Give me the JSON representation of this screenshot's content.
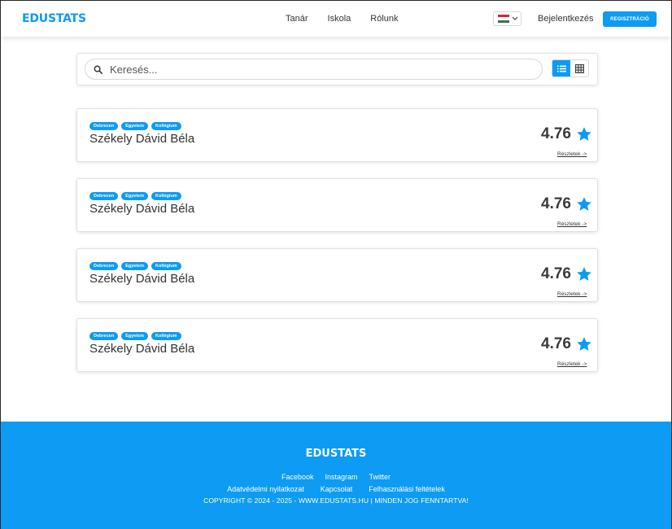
{
  "header": {
    "brand": "EDUSTATS",
    "nav": [
      "Tanár",
      "Iskola",
      "Rólunk"
    ],
    "login": "Bejelentkezés",
    "register": "REGISZTRÁCIÓ",
    "language_flag": "hungary-flag-icon"
  },
  "search": {
    "placeholder": "Keresés...",
    "value": "",
    "active_view": "list"
  },
  "results": [
    {
      "tags": [
        "Debrecen",
        "Egyetem",
        "Kollégium"
      ],
      "name": "Székely Dávid Béla",
      "rating": "4.76",
      "details": "Részletek ->"
    },
    {
      "tags": [
        "Debrecen",
        "Egyetem",
        "Kollégium"
      ],
      "name": "Székely Dávid Béla",
      "rating": "4.76",
      "details": "Részletek ->"
    },
    {
      "tags": [
        "Debrecen",
        "Egyetem",
        "Kollégium"
      ],
      "name": "Székely Dávid Béla",
      "rating": "4.76",
      "details": "Részletek ->"
    },
    {
      "tags": [
        "Debrecen",
        "Egyetem",
        "Kollégium"
      ],
      "name": "Székely Dávid Béla",
      "rating": "4.76",
      "details": "Részletek ->"
    }
  ],
  "footer": {
    "brand": "EDUSTATS",
    "social": [
      "Facebook",
      "Instagram",
      "Twitter"
    ],
    "links": [
      "Adatvédelmi nyilatkozat",
      "Kapcsolat",
      "Felhasználási feltételek"
    ],
    "copyright": "COPYRIGHT © 2024 - 2025 - WWW.EDUSTATS.HU | MINDEN JOG FENNTARTVA!"
  },
  "colors": {
    "accent": "#0d9bf3",
    "text": "#333333",
    "flag_red": "#cd2a3e",
    "flag_white": "#ffffff",
    "flag_green": "#436f4d"
  }
}
